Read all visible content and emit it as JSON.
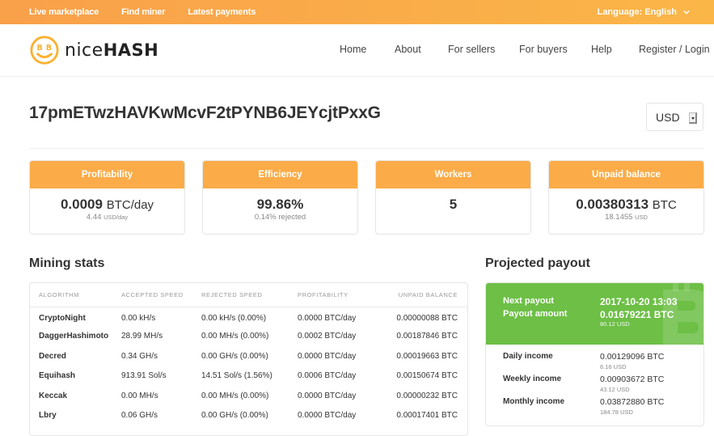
{
  "topbar": {
    "links": [
      "Live marketplace",
      "Find miner",
      "Latest payments"
    ],
    "language_label": "Language: English",
    "language_icon": "chevron-down-icon"
  },
  "header": {
    "logo_nice": "nice",
    "logo_hash": "HASH",
    "nav": [
      "Home",
      "About",
      "For sellers",
      "For buyers",
      "Help",
      "Register / Login"
    ]
  },
  "address": "17pmETwzHAVKwMcvF2tPYNB6JEYcjtPxxG",
  "currency_select": {
    "value": "USD"
  },
  "cards": [
    {
      "title": "Profitability",
      "value": "0.0009",
      "unit": "BTC/day",
      "sub_value": "4.44",
      "sub_unit": "USD/day"
    },
    {
      "title": "Efficiency",
      "value": "99.86%",
      "unit": "",
      "sub_value": "0.14% rejected",
      "sub_unit": ""
    },
    {
      "title": "Workers",
      "value": "5",
      "unit": "",
      "sub_value": "",
      "sub_unit": ""
    },
    {
      "title": "Unpaid balance",
      "value": "0.00380313",
      "unit": "BTC",
      "sub_value": "18.1455",
      "sub_unit": "USD"
    }
  ],
  "mining_stats": {
    "title": "Mining stats",
    "columns": [
      "ALGORITHM",
      "ACCEPTED SPEED",
      "REJECTED SPEED",
      "PROFITABILITY",
      "UNPAID BALANCE"
    ],
    "rows": [
      [
        "CryptoNight",
        "0.00 kH/s",
        "0.00 kH/s (0.00%)",
        "0.0000 BTC/day",
        "0.00000088 BTC"
      ],
      [
        "DaggerHashimoto",
        "28.99 MH/s",
        "0.00 MH/s (0.00%)",
        "0.0002 BTC/day",
        "0.00187846 BTC"
      ],
      [
        "Decred",
        "0.34 GH/s",
        "0.00 GH/s (0.00%)",
        "0.0000 BTC/day",
        "0.00019663 BTC"
      ],
      [
        "Equihash",
        "913.91 Sol/s",
        "14.51 Sol/s (1.56%)",
        "0.0006 BTC/day",
        "0.00150674 BTC"
      ],
      [
        "Keccak",
        "0.00 MH/s",
        "0.00 MH/s (0.00%)",
        "0.0000 BTC/day",
        "0.00000232 BTC"
      ],
      [
        "Lbry",
        "0.06 GH/s",
        "0.00 GH/s (0.00%)",
        "0.0000 BTC/day",
        "0.00017401 BTC"
      ]
    ]
  },
  "projected_payout": {
    "title": "Projected payout",
    "next_payout_label": "Next payout",
    "next_payout_value": "2017-10-20 13:03",
    "payout_amount_label": "Payout amount",
    "payout_amount_value": "0.01679221 BTC",
    "payout_amount_usd": "80.12 USD",
    "income": [
      {
        "label": "Daily income",
        "btc": "0.00129096 BTC",
        "usd": "6.16 USD"
      },
      {
        "label": "Weekly income",
        "btc": "0.00903672 BTC",
        "usd": "43.12 USD"
      },
      {
        "label": "Monthly income",
        "btc": "0.03872880 BTC",
        "usd": "184.78 USD"
      }
    ]
  },
  "colors": {
    "brand_orange": "#fbac48",
    "payout_green": "#6dbf46"
  }
}
